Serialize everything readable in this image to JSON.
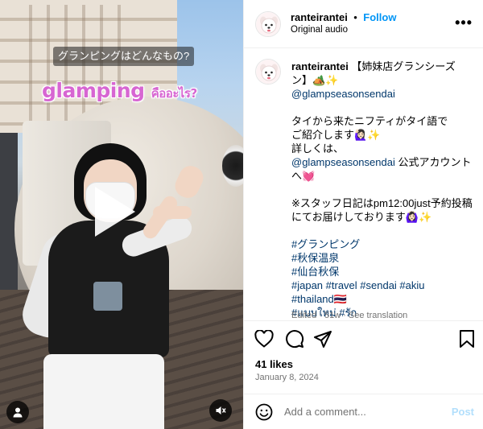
{
  "video": {
    "caption_top": "グランピングはどんなもの?",
    "caption_big": "glamping",
    "caption_big_thai": "คืออะไร?"
  },
  "header": {
    "username": "ranteirantei",
    "separator": "•",
    "follow_label": "Follow",
    "audio_label": "Original audio",
    "more_label": "•••"
  },
  "post": {
    "username": "ranteirantei",
    "lines": [
      " 【姉妹店グランシーズ",
      "ン】🏕️✨",
      "@glampseasonsendai",
      "",
      "タイから来たニフティがタイ語で",
      "ご紹介します🙋🏻‍♀️✨",
      "詳しくは、",
      "@glampseasonsendai 公式アカウント",
      "へ💓",
      "",
      "※スタッフ日記はpm12:00just予約投稿",
      "にてお届けしております🙆🏻‍♀️✨",
      "",
      "#グランピング",
      "#秋保温泉",
      "#仙台秋保",
      "#japan #travel #sendai #akiu",
      "#thailand🇹🇭",
      "#แบบใหม่ #รัก"
    ],
    "edited_label": "Edited · 51w · See translation"
  },
  "actions": {
    "likes": "41 likes",
    "date": "January 8, 2024"
  },
  "comment": {
    "placeholder": "Add a comment...",
    "post_label": "Post"
  },
  "colors": {
    "link_blue": "#0095f6",
    "hashtag": "#00376b",
    "caption_pink": "#d766d2"
  }
}
